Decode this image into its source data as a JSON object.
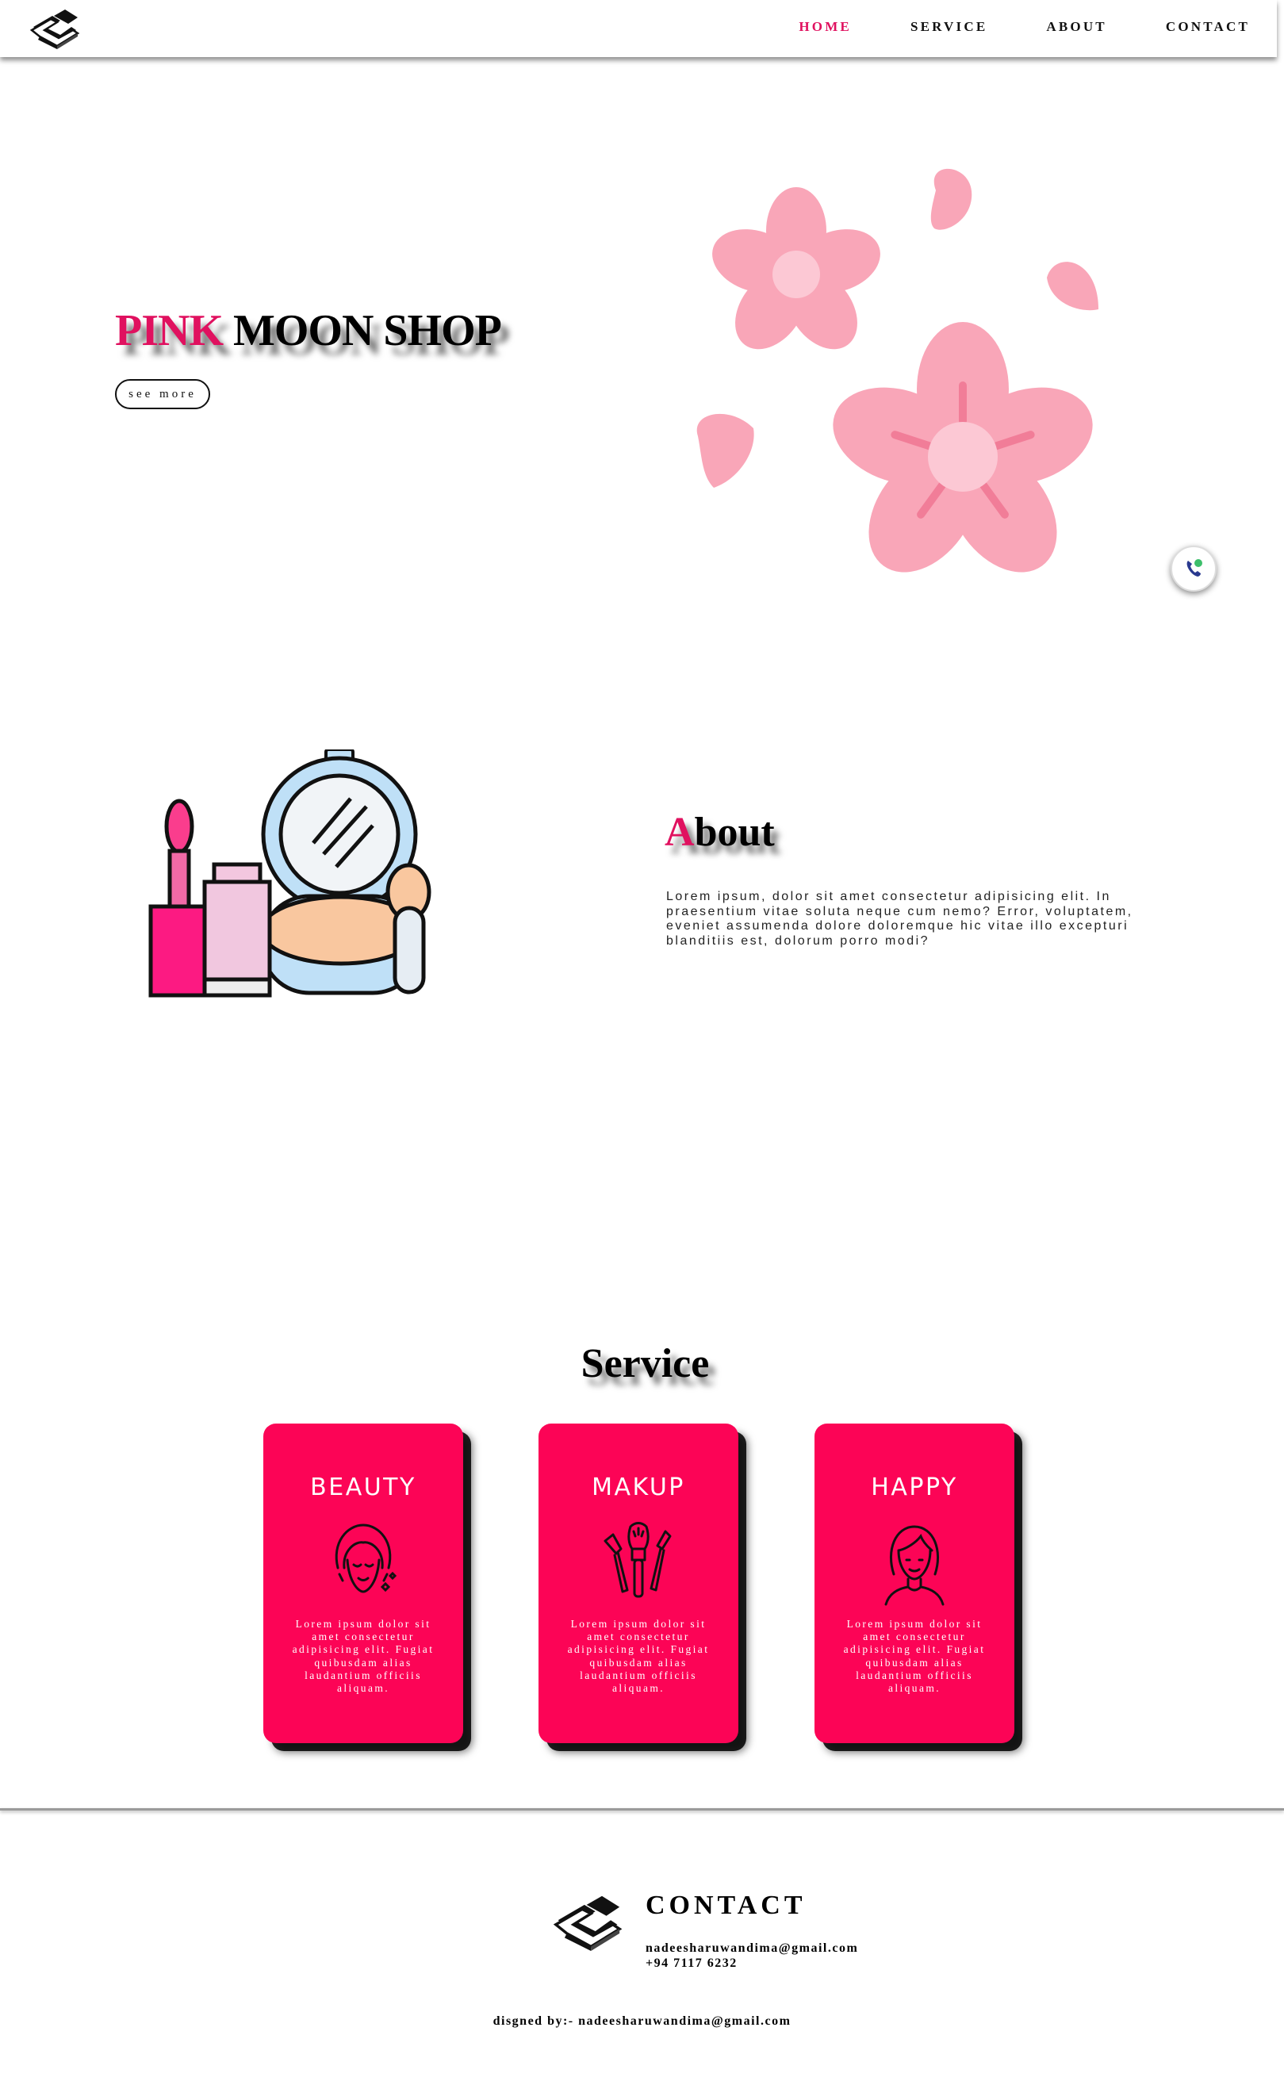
{
  "nav": {
    "items": [
      {
        "label": "HOME",
        "active": true
      },
      {
        "label": "SERVICE",
        "active": false
      },
      {
        "label": "ABOUT",
        "active": false
      },
      {
        "label": "CONTACT",
        "active": false
      }
    ]
  },
  "hero": {
    "title_pink": "PINK",
    "title_rest": " MOON SHOP",
    "button_label": "see more"
  },
  "about": {
    "title_first": "A",
    "title_rest": "bout",
    "text": "Lorem ipsum, dolor sit amet consectetur adipisicing elit. In praesentium vitae soluta neque cum nemo? Error, voluptatem, eveniet assumenda dolore doloremque hic vitae illo excepturi blanditiis est, dolorum porro modi?"
  },
  "service": {
    "title": "Service",
    "cards": [
      {
        "title": "BEAUTY",
        "icon": "woman-face-icon",
        "text": "Lorem ipsum dolor sit amet consectetur adipisicing elit. Fugiat quibusdam alias laudantium officiis aliquam."
      },
      {
        "title": "MAKUP",
        "icon": "makeup-brushes-icon",
        "text": "Lorem ipsum dolor sit amet consectetur adipisicing elit. Fugiat quibusdam alias laudantium officiis aliquam."
      },
      {
        "title": "HAPPY",
        "icon": "woman-portrait-icon",
        "text": "Lorem ipsum dolor sit amet consectetur adipisicing elit. Fugiat quibusdam alias laudantium officiis aliquam."
      }
    ]
  },
  "footer": {
    "heading": "CONTACT",
    "email": "nadeesharuwandima@gmail.com",
    "phone": "+94 7117 6232",
    "credit": "disgned by:- nadeesharuwandima@gmail.com"
  },
  "colors": {
    "accent": "#e0115f",
    "card": "#fc0456",
    "flower": "#f9a6b8"
  }
}
